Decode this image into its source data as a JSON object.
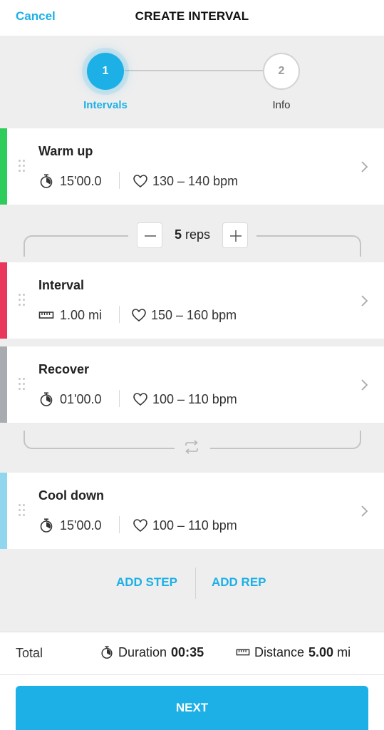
{
  "header": {
    "cancel_label": "Cancel",
    "title": "CREATE INTERVAL"
  },
  "stepper": {
    "steps": [
      {
        "number": "1",
        "label": "Intervals",
        "active": true
      },
      {
        "number": "2",
        "label": "Info",
        "active": false
      }
    ]
  },
  "steps": [
    {
      "name": "Warm up",
      "metric_icon": "stopwatch-icon",
      "metric": "15'00.0",
      "hr_icon": "heart-icon",
      "heart_rate": "130 – 140 bpm",
      "color": "#2ecc5b"
    },
    {
      "name": "Interval",
      "metric_icon": "ruler-icon",
      "metric": "1.00 mi",
      "hr_icon": "heart-icon",
      "heart_rate": "150 – 160 bpm",
      "color": "#e8365d"
    },
    {
      "name": "Recover",
      "metric_icon": "stopwatch-icon",
      "metric": "01'00.0",
      "hr_icon": "heart-icon",
      "heart_rate": "100 – 110 bpm",
      "color": "#a8abb0"
    },
    {
      "name": "Cool down",
      "metric_icon": "stopwatch-icon",
      "metric": "15'00.0",
      "hr_icon": "heart-icon",
      "heart_rate": "100 – 110 bpm",
      "color": "#8fd6ee"
    }
  ],
  "repeat": {
    "count": "5",
    "label": "reps"
  },
  "actions": {
    "add_step": "ADD STEP",
    "add_rep": "ADD REP"
  },
  "footer": {
    "total_label": "Total",
    "duration_label": "Duration",
    "duration_value": "00:35",
    "distance_label": "Distance",
    "distance_value": "5.00",
    "distance_unit": "mi",
    "next_label": "NEXT"
  },
  "colors": {
    "accent": "#1cb0e6"
  }
}
